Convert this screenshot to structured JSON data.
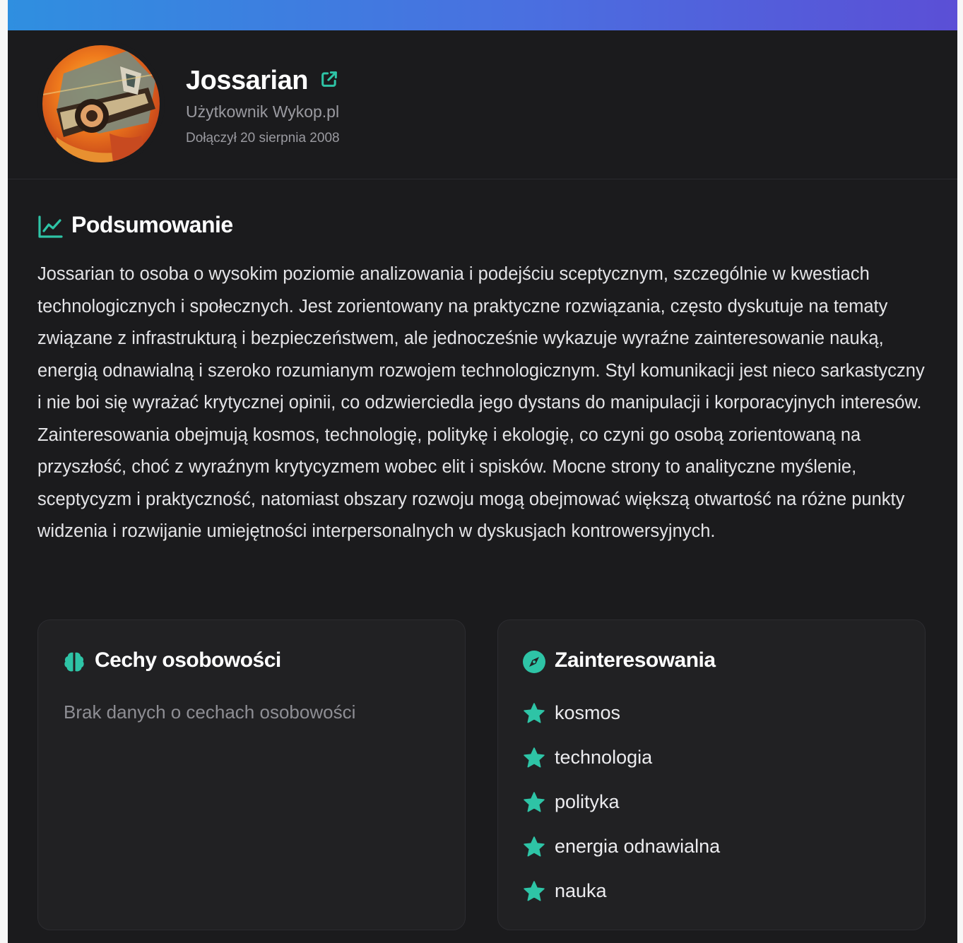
{
  "colors": {
    "accent": "#2ec4a6",
    "background": "#1b1b1d",
    "panel": "#212123",
    "banner_start": "#2f8fe0",
    "banner_end": "#5b4fd6"
  },
  "profile": {
    "avatar_icon": "user-avatar",
    "name": "Jossarian",
    "link_icon": "external-link-icon",
    "role": "Użytkownik Wykop.pl",
    "joined": "Dołączył 20 sierpnia 2008"
  },
  "summary": {
    "icon": "chart-line-icon",
    "title": "Podsumowanie",
    "text": "Jossarian to osoba o wysokim poziomie analizowania i podejściu sceptycznym, szczególnie w kwestiach technologicznych i społecznych. Jest zorientowany na praktyczne rozwiązania, często dyskutuje na tematy związane z infrastrukturą i bezpieczeństwem, ale jednocześnie wykazuje wyraźne zainteresowanie nauką, energią odnawialną i szeroko rozumianym rozwojem technologicznym. Styl komunikacji jest nieco sarkastyczny i nie boi się wyrażać krytycznej opinii, co odzwierciedla jego dystans do manipulacji i korporacyjnych interesów. Zainteresowania obejmują kosmos, technologię, politykę i ekologię, co czyni go osobą zorientowaną na przyszłość, choć z wyraźnym krytycyzmem wobec elit i spisków. Mocne strony to analityczne myślenie, sceptycyzm i praktyczność, natomiast obszary rozwoju mogą obejmować większą otwartość na różne punkty widzenia i rozwijanie umiejętności interpersonalnych w dyskusjach kontrowersyjnych."
  },
  "personality": {
    "icon": "brain-icon",
    "title": "Cechy osobowości",
    "empty_text": "Brak danych o cechach osobowości"
  },
  "interests": {
    "icon": "compass-icon",
    "title": "Zainteresowania",
    "item_icon": "star-icon",
    "items": [
      "kosmos",
      "technologia",
      "polityka",
      "energia odnawialna",
      "nauka"
    ]
  }
}
